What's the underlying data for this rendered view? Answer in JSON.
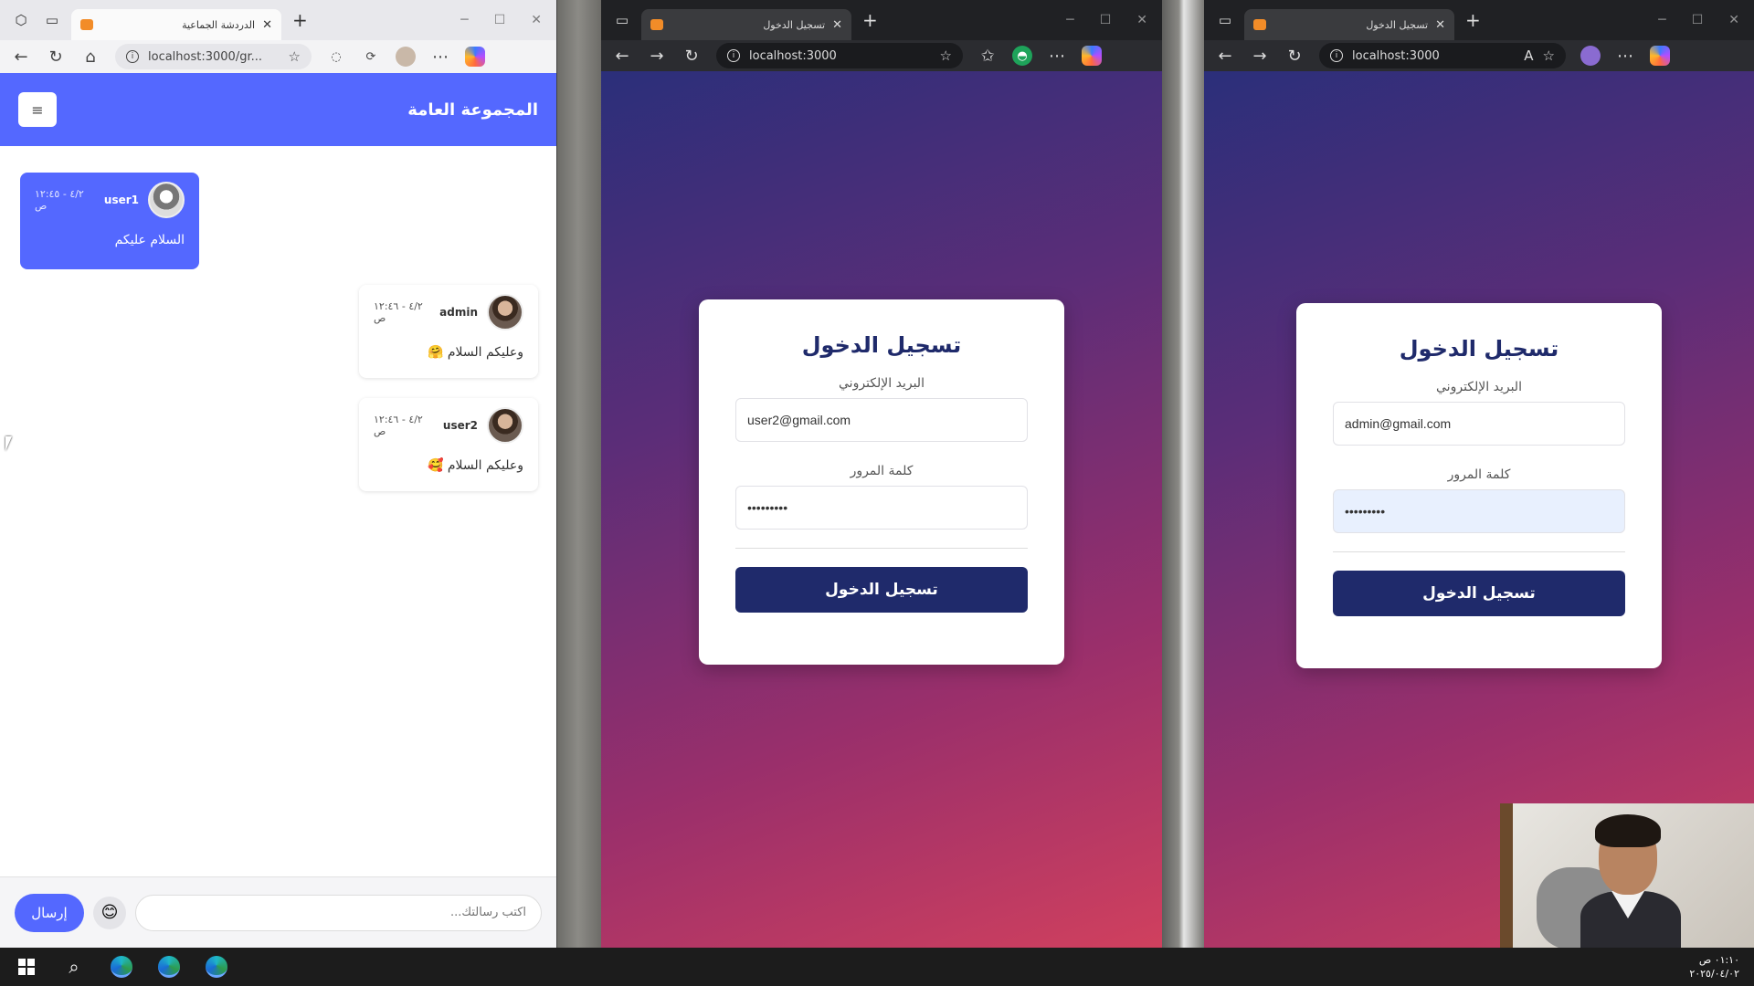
{
  "chat_window": {
    "tab_title": "الدردشة الجماعية",
    "url": "localhost:3000/gr...",
    "header_title": "المجموعة العامة",
    "menu_icon": "≡",
    "messages": [
      {
        "user": "user1",
        "time": "٤/٢ - ١٢:٤٥ ص",
        "text": "السلام عليكم"
      },
      {
        "user": "admin",
        "time": "٤/٢ - ١٢:٤٦ ص",
        "text": "وعليكم السلام 🤗"
      },
      {
        "user": "user2",
        "time": "٤/٢ - ١٢:٤٦ ص",
        "text": "وعليكم السلام 🥰"
      }
    ],
    "composer": {
      "placeholder": "اكتب رسالتك...",
      "send_label": "إرسال",
      "emoji": "😊"
    }
  },
  "login_window_1": {
    "tab_title": "تسجيل الدخول",
    "url": "localhost:3000",
    "title": "تسجيل الدخول",
    "email_label": "البريد الإلكتروني",
    "email_value": "user2@gmail.com",
    "password_label": "كلمة المرور",
    "password_value": "•••••••••",
    "button_label": "تسجيل الدخول"
  },
  "login_window_2": {
    "tab_title": "تسجيل الدخول",
    "url": "localhost:3000",
    "title": "تسجيل الدخول",
    "email_label": "البريد الإلكتروني",
    "email_value": "admin@gmail.com",
    "password_label": "كلمة المرور",
    "password_value": "•••••••••",
    "button_label": "تسجيل الدخول"
  },
  "taskbar": {
    "time": "٠١:١٠ ص",
    "date": "٢٠٢٥/٠٤/٠٢"
  },
  "colors": {
    "chat_accent": "#5468ff",
    "login_button": "#1f2a6b",
    "tab_favicon": "#f28c28"
  }
}
